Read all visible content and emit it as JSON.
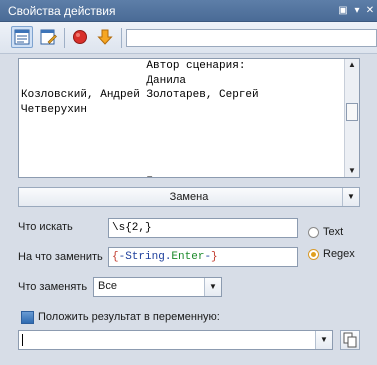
{
  "window": {
    "title": "Свойства действия",
    "buttons": [
      "▣",
      "▾",
      "✕"
    ]
  },
  "toolbar": {
    "icons": [
      "properties-icon",
      "edit-form-icon",
      "record-icon",
      "download-arrow-icon"
    ],
    "input_value": ""
  },
  "editor": {
    "text": "                   Автор сценария:\n                   Данила\nКозловский, Андрей Золотарев, Сергей\nЧетверухин\n\n\n\n\n                   Продюсер:"
  },
  "section_dropdown": {
    "label": "Замена"
  },
  "find": {
    "label": "Что искать",
    "value": "\\s{2,}"
  },
  "replace": {
    "label": "На что заменить",
    "value_parts": [
      {
        "text": "{",
        "color": "#c0392b"
      },
      {
        "text": "-String.",
        "color": "#1d3f9c"
      },
      {
        "text": "Enter",
        "color": "#1b8a2a"
      },
      {
        "text": "-",
        "color": "#1d3f9c"
      },
      {
        "text": "}",
        "color": "#c0392b"
      }
    ]
  },
  "mode": {
    "text_label": "Text",
    "regex_label": "Regex",
    "selected": "Regex"
  },
  "scope": {
    "label": "Что заменять",
    "value": "Все"
  },
  "result": {
    "checkbox_label": "Положить результат в переменную:",
    "variable_value": ""
  }
}
